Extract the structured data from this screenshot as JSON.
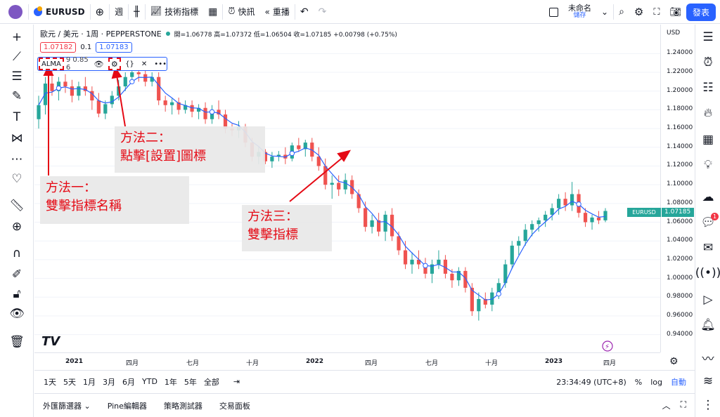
{
  "topbar": {
    "symbol": "EURUSD",
    "add_icon": "plus-circle-icon",
    "interval": "週",
    "indicators_label": "技術指標",
    "alert_label": "快訊",
    "replay_label": "重播",
    "layout_name": "未命名",
    "layout_save": "儲存",
    "publish_label": "發表"
  },
  "legend": {
    "title": "歐元 / 美元 · 1周 · PEPPERSTONE",
    "ohlc": "開=1.06778 高=1.07372 低=1.06504 收=1.07185 +0.00798 (+0.75%)",
    "sell_price": "1.07182",
    "spread": "0.1",
    "buy_price": "1.07183"
  },
  "indicator": {
    "name": "ALMA",
    "params": "9 0.85 6"
  },
  "callouts": {
    "method1": [
      "方法一：",
      "雙擊指標名稱"
    ],
    "method2": [
      "方法二：",
      "點擊[設置]圖標"
    ],
    "method3": [
      "方法三：",
      "雙擊指標"
    ]
  },
  "price_axis": {
    "currency": "USD",
    "ticks": [
      "1.24000",
      "1.22000",
      "1.20000",
      "1.18000",
      "1.16000",
      "1.14000",
      "1.12000",
      "1.10000",
      "1.08000",
      "1.06000",
      "1.04000",
      "1.02000",
      "1.00000",
      "0.98000",
      "0.96000",
      "0.94000"
    ],
    "last_symbol": "EURUSD",
    "last_price": "1.07185"
  },
  "time_axis": {
    "ticks": [
      "2021",
      "四月",
      "七月",
      "十月",
      "2022",
      "四月",
      "七月",
      "十月",
      "2023",
      "四月"
    ]
  },
  "range_bar": {
    "ranges": [
      "1天",
      "5天",
      "1月",
      "3月",
      "6月",
      "YTD",
      "1年",
      "5年",
      "全部"
    ],
    "clock": "23:34:49 (UTC+8)",
    "percent": "%",
    "log": "log",
    "auto": "自動"
  },
  "bottom_panel": {
    "tabs": [
      "外匯篩選器",
      "Pine編輯器",
      "策略測試器",
      "交易面板"
    ]
  },
  "colors": {
    "up": "#26a69a",
    "down": "#ef5350",
    "ma": "#2962ff",
    "accent": "#2962ff",
    "annotation": "#e50914"
  },
  "chart_data": {
    "type": "candlestick",
    "ylim": [
      0.93,
      1.25
    ],
    "candles": [
      [
        1.17,
        1.195,
        1.16,
        1.185
      ],
      [
        1.185,
        1.215,
        1.175,
        1.208
      ],
      [
        1.208,
        1.225,
        1.195,
        1.2
      ],
      [
        1.2,
        1.215,
        1.19,
        1.21
      ],
      [
        1.21,
        1.218,
        1.198,
        1.205
      ],
      [
        1.205,
        1.212,
        1.188,
        1.195
      ],
      [
        1.195,
        1.21,
        1.19,
        1.205
      ],
      [
        1.205,
        1.215,
        1.195,
        1.2
      ],
      [
        1.2,
        1.205,
        1.18,
        1.19
      ],
      [
        1.19,
        1.198,
        1.172,
        1.176
      ],
      [
        1.176,
        1.19,
        1.17,
        1.186
      ],
      [
        1.186,
        1.2,
        1.182,
        1.195
      ],
      [
        1.195,
        1.212,
        1.19,
        1.205
      ],
      [
        1.205,
        1.22,
        1.2,
        1.215
      ],
      [
        1.215,
        1.228,
        1.208,
        1.22
      ],
      [
        1.22,
        1.225,
        1.21,
        1.218
      ],
      [
        1.218,
        1.225,
        1.205,
        1.21
      ],
      [
        1.21,
        1.22,
        1.205,
        1.215
      ],
      [
        1.215,
        1.22,
        1.185,
        1.19
      ],
      [
        1.19,
        1.195,
        1.178,
        1.185
      ],
      [
        1.185,
        1.192,
        1.175,
        1.188
      ],
      [
        1.188,
        1.193,
        1.175,
        1.18
      ],
      [
        1.18,
        1.19,
        1.176,
        1.185
      ],
      [
        1.185,
        1.19,
        1.172,
        1.178
      ],
      [
        1.178,
        1.186,
        1.17,
        1.182
      ],
      [
        1.182,
        1.188,
        1.165,
        1.17
      ],
      [
        1.17,
        1.185,
        1.165,
        1.18
      ],
      [
        1.18,
        1.19,
        1.17,
        1.175
      ],
      [
        1.175,
        1.18,
        1.155,
        1.16
      ],
      [
        1.16,
        1.165,
        1.152,
        1.158
      ],
      [
        1.158,
        1.168,
        1.15,
        1.162
      ],
      [
        1.162,
        1.165,
        1.14,
        1.145
      ],
      [
        1.145,
        1.15,
        1.125,
        1.13
      ],
      [
        1.13,
        1.14,
        1.122,
        1.135
      ],
      [
        1.135,
        1.138,
        1.122,
        1.125
      ],
      [
        1.125,
        1.135,
        1.118,
        1.13
      ],
      [
        1.13,
        1.136,
        1.125,
        1.132
      ],
      [
        1.132,
        1.14,
        1.122,
        1.128
      ],
      [
        1.128,
        1.145,
        1.125,
        1.142
      ],
      [
        1.142,
        1.15,
        1.135,
        1.138
      ],
      [
        1.138,
        1.148,
        1.13,
        1.145
      ],
      [
        1.145,
        1.15,
        1.125,
        1.13
      ],
      [
        1.13,
        1.14,
        1.115,
        1.12
      ],
      [
        1.12,
        1.128,
        1.095,
        1.1
      ],
      [
        1.1,
        1.11,
        1.085,
        1.102
      ],
      [
        1.102,
        1.11,
        1.088,
        1.095
      ],
      [
        1.095,
        1.112,
        1.09,
        1.105
      ],
      [
        1.105,
        1.11,
        1.085,
        1.09
      ],
      [
        1.09,
        1.095,
        1.07,
        1.075
      ],
      [
        1.075,
        1.082,
        1.05,
        1.055
      ],
      [
        1.055,
        1.068,
        1.048,
        1.062
      ],
      [
        1.062,
        1.07,
        1.045,
        1.05
      ],
      [
        1.05,
        1.072,
        1.04,
        1.068
      ],
      [
        1.068,
        1.075,
        1.04,
        1.045
      ],
      [
        1.045,
        1.05,
        1.025,
        1.03
      ],
      [
        1.03,
        1.04,
        1.01,
        1.015
      ],
      [
        1.015,
        1.028,
        1.005,
        1.02
      ],
      [
        1.02,
        1.03,
        1.01,
        1.015
      ],
      [
        1.015,
        1.022,
        1.0,
        1.005
      ],
      [
        1.005,
        1.02,
        0.995,
        1.015
      ],
      [
        1.015,
        1.03,
        1.01,
        1.02
      ],
      [
        1.02,
        1.025,
        1.0,
        1.005
      ],
      [
        1.005,
        1.01,
        0.99,
        0.998
      ],
      [
        0.998,
        1.012,
        0.992,
        1.008
      ],
      [
        1.008,
        1.012,
        0.985,
        0.99
      ],
      [
        0.99,
        0.995,
        0.96,
        0.965
      ],
      [
        0.965,
        0.985,
        0.955,
        0.978
      ],
      [
        0.978,
        0.985,
        0.968,
        0.972
      ],
      [
        0.972,
        0.99,
        0.965,
        0.985
      ],
      [
        0.985,
        1.0,
        0.978,
        0.995
      ],
      [
        0.995,
        1.02,
        0.99,
        1.015
      ],
      [
        1.015,
        1.04,
        1.01,
        1.035
      ],
      [
        1.035,
        1.045,
        1.025,
        1.04
      ],
      [
        1.04,
        1.058,
        1.035,
        1.052
      ],
      [
        1.052,
        1.062,
        1.045,
        1.058
      ],
      [
        1.058,
        1.065,
        1.05,
        1.062
      ],
      [
        1.062,
        1.072,
        1.055,
        1.068
      ],
      [
        1.068,
        1.08,
        1.062,
        1.075
      ],
      [
        1.075,
        1.09,
        1.068,
        1.085
      ],
      [
        1.085,
        1.092,
        1.072,
        1.078
      ],
      [
        1.078,
        1.103,
        1.072,
        1.09
      ],
      [
        1.09,
        1.095,
        1.065,
        1.07
      ],
      [
        1.07,
        1.075,
        1.055,
        1.06
      ],
      [
        1.06,
        1.068,
        1.052,
        1.065
      ],
      [
        1.065,
        1.072,
        1.058,
        1.062
      ],
      [
        1.062,
        1.075,
        1.06,
        1.072
      ]
    ]
  }
}
